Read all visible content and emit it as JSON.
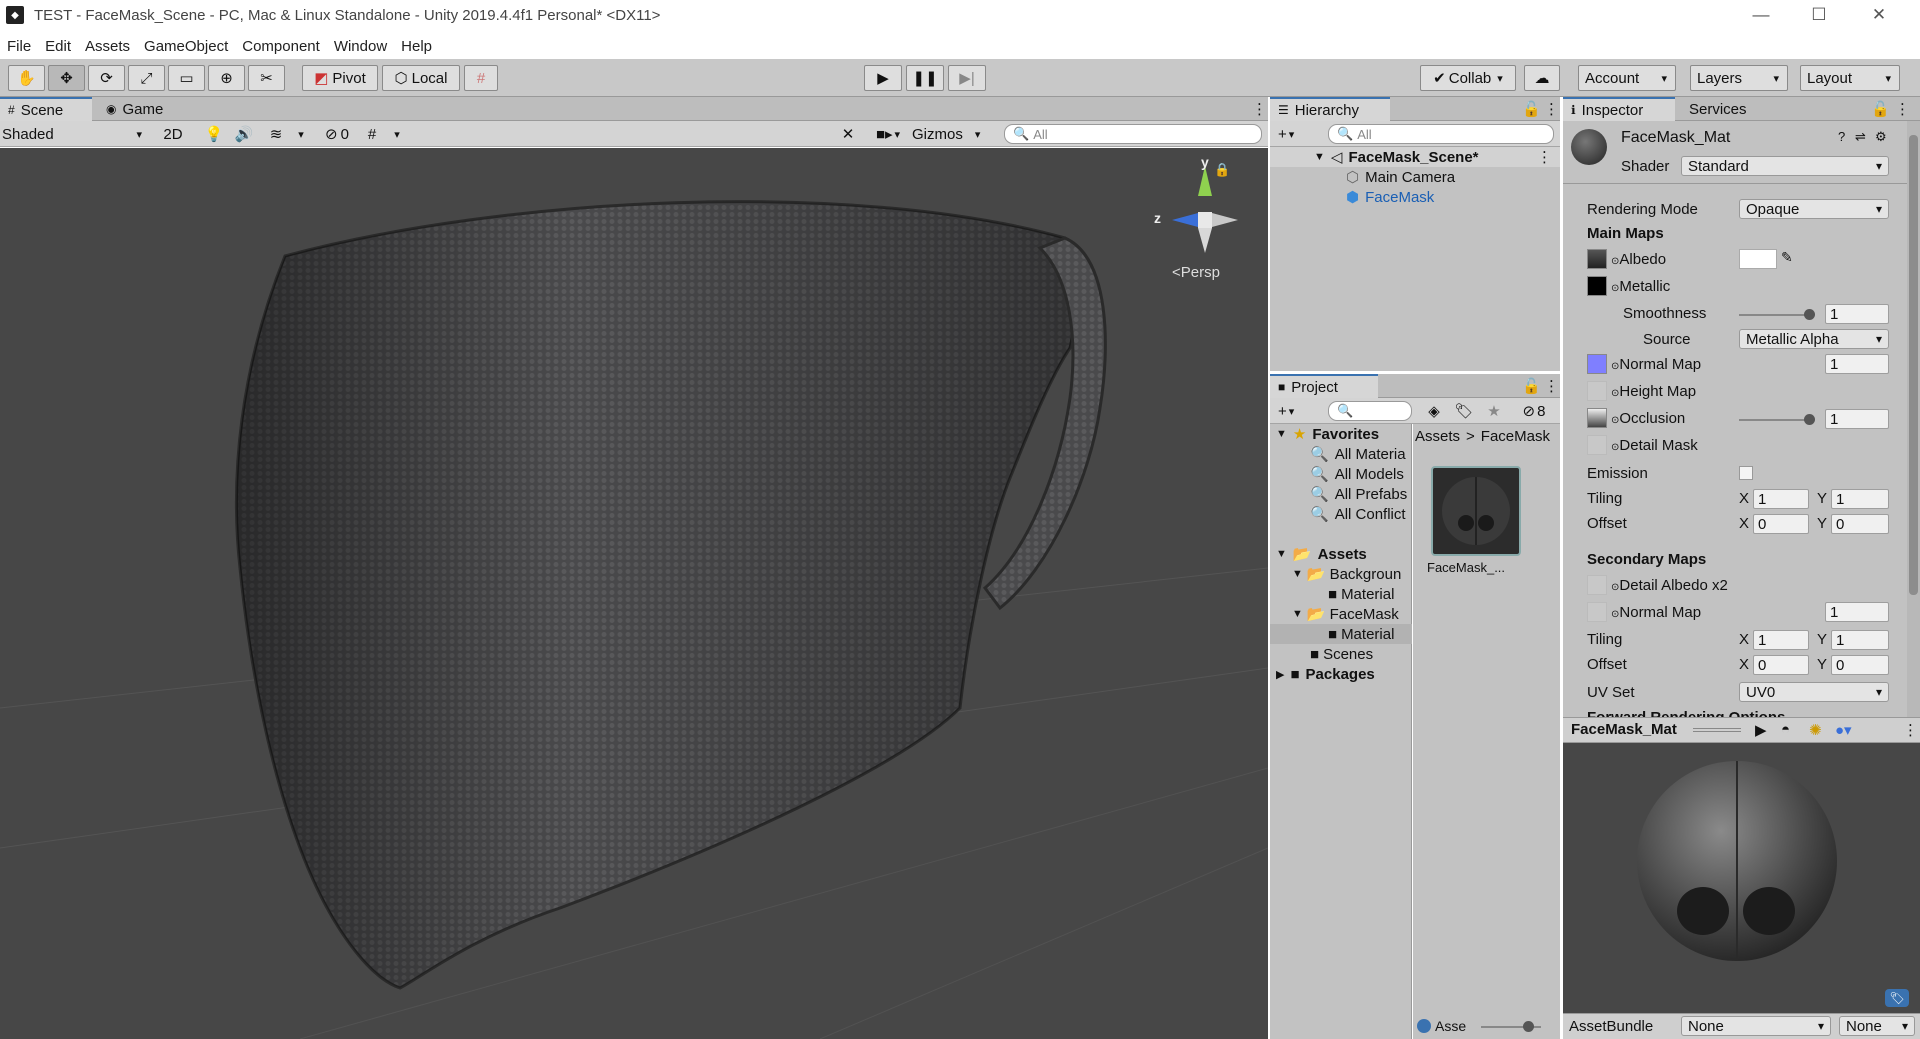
{
  "window": {
    "title": "TEST - FaceMask_Scene - PC, Mac & Linux Standalone - Unity 2019.4.4f1 Personal* <DX11>",
    "minimize": "—",
    "maximize": "☐",
    "close": "✕"
  },
  "menu": [
    "File",
    "Edit",
    "Assets",
    "GameObject",
    "Component",
    "Window",
    "Help"
  ],
  "toolbar": {
    "pivot": "Pivot",
    "local": "Local",
    "collab": "Collab",
    "account": "Account",
    "layers": "Layers",
    "layout": "Layout"
  },
  "scene": {
    "tab_scene": "Scene",
    "tab_game": "Game",
    "shading": "Shaded",
    "mode_2d": "2D",
    "hidden_count": "0",
    "gizmos": "Gizmos",
    "search_placeholder": "All",
    "gizmo_y": "y",
    "gizmo_z": "z",
    "persp": "Persp"
  },
  "hierarchy": {
    "tab": "Hierarchy",
    "search_placeholder": "All",
    "scene_name": "FaceMask_Scene*",
    "items": [
      "Main Camera",
      "FaceMask"
    ]
  },
  "project": {
    "tab": "Project",
    "hidden_count": "8",
    "favorites": "Favorites",
    "fav_items": [
      "All Materia",
      "All Models",
      "All Prefabs",
      "All Conflict"
    ],
    "assets": "Assets",
    "tree": [
      {
        "label": "Backgroun",
        "level": 1
      },
      {
        "label": "Material",
        "level": 2
      },
      {
        "label": "FaceMask",
        "level": 1
      },
      {
        "label": "Material",
        "level": 2
      },
      {
        "label": "Scenes",
        "level": 1
      }
    ],
    "packages": "Packages",
    "breadcrumb_root": "Assets",
    "breadcrumb_sep": ">",
    "breadcrumb_folder": "FaceMask",
    "asset_name": "FaceMask_...",
    "footer_label": "Asse"
  },
  "inspector": {
    "tab_inspector": "Inspector",
    "tab_services": "Services",
    "material_name": "FaceMask_Mat",
    "shader_label": "Shader",
    "shader_value": "Standard",
    "rendering_mode_label": "Rendering Mode",
    "rendering_mode_value": "Opaque",
    "main_maps": "Main Maps",
    "albedo": "Albedo",
    "metallic": "Metallic",
    "smoothness_label": "Smoothness",
    "smoothness_value": "1",
    "smoothness_fraction": 1.0,
    "source_label": "Source",
    "source_value": "Metallic Alpha",
    "normal_map": "Normal Map",
    "normal_value": "1",
    "height_map": "Height Map",
    "occlusion": "Occlusion",
    "occlusion_value": "1",
    "occlusion_fraction": 1.0,
    "detail_mask": "Detail Mask",
    "emission": "Emission",
    "tiling": "Tiling",
    "offset": "Offset",
    "x": "X",
    "y": "Y",
    "tiling_x": "1",
    "tiling_y": "1",
    "offset_x": "0",
    "offset_y": "0",
    "secondary_maps": "Secondary Maps",
    "detail_albedo": "Detail Albedo x2",
    "sec_normal_map": "Normal Map",
    "sec_normal_value": "1",
    "sec_tiling_x": "1",
    "sec_tiling_y": "1",
    "sec_offset_x": "0",
    "sec_offset_y": "0",
    "uv_set_label": "UV Set",
    "uv_set_value": "UV0",
    "cut_off": "Forward Rendering Options",
    "preview_title": "FaceMask_Mat",
    "assetbundle_label": "AssetBundle",
    "assetbundle_value": "None",
    "assetbundle_variant": "None"
  },
  "colors": {
    "accent": "#3a72b0",
    "selection": "#1a5fb4",
    "normal_map_swatch": "#7f7fff"
  }
}
